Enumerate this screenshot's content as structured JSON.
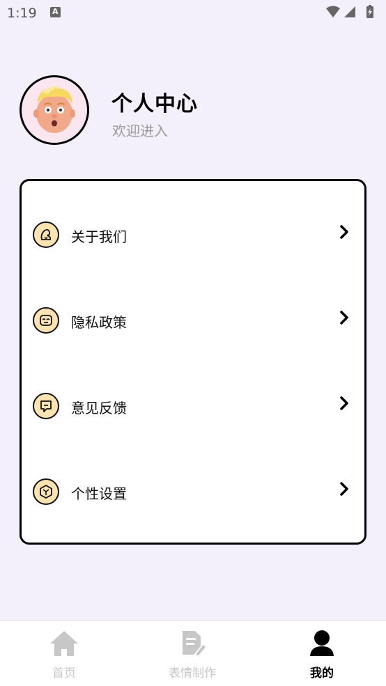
{
  "status_bar": {
    "time": "1:19"
  },
  "profile": {
    "title": "个人中心",
    "subtitle": "欢迎进入"
  },
  "menu": {
    "items": [
      {
        "label": "关于我们",
        "icon": "about-icon"
      },
      {
        "label": "隐私政策",
        "icon": "privacy-icon"
      },
      {
        "label": "意见反馈",
        "icon": "feedback-icon"
      },
      {
        "label": "个性设置",
        "icon": "settings-icon"
      }
    ]
  },
  "bottom_nav": {
    "tabs": [
      {
        "label": "首页",
        "icon": "home-icon",
        "active": false
      },
      {
        "label": "表情制作",
        "icon": "document-edit-icon",
        "active": false
      },
      {
        "label": "我的",
        "icon": "user-icon",
        "active": true
      }
    ]
  },
  "colors": {
    "background": "#f3effb",
    "icon_fill": "#fde3b0",
    "inactive_tab": "#c7c7c7",
    "active_tab": "#000000"
  }
}
